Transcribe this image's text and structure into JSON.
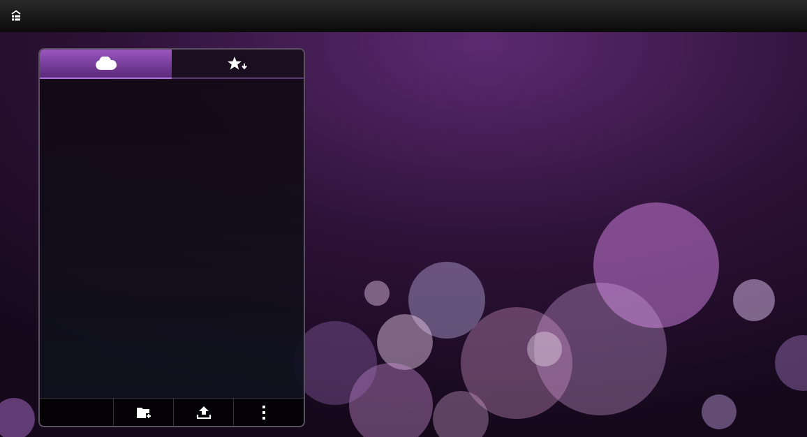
{
  "tabs": [
    {
      "kind": "cloud",
      "selected": true
    },
    {
      "kind": "starred",
      "selected": false
    }
  ],
  "toolbar": [
    {
      "kind": "new-folder"
    },
    {
      "kind": "upload"
    },
    {
      "kind": "more"
    }
  ]
}
